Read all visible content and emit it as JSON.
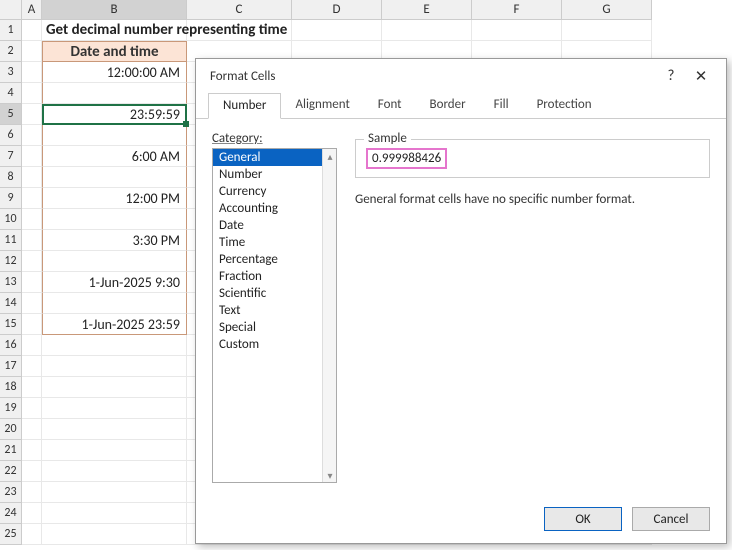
{
  "columns": [
    "A",
    "B",
    "C",
    "D",
    "E",
    "F",
    "G"
  ],
  "selected_col": "B",
  "selected_row": 5,
  "title_cell": "Get decimal number representing time",
  "header_cell": "Date and time",
  "data_rows": [
    {
      "r": 3,
      "v": "12:00:00 AM"
    },
    {
      "r": 4,
      "v": ""
    },
    {
      "r": 5,
      "v": "23:59:59"
    },
    {
      "r": 6,
      "v": ""
    },
    {
      "r": 7,
      "v": "6:00 AM"
    },
    {
      "r": 8,
      "v": ""
    },
    {
      "r": 9,
      "v": "12:00 PM"
    },
    {
      "r": 10,
      "v": ""
    },
    {
      "r": 11,
      "v": "3:30 PM"
    },
    {
      "r": 12,
      "v": ""
    },
    {
      "r": 13,
      "v": "1-Jun-2025 9:30"
    },
    {
      "r": 14,
      "v": ""
    },
    {
      "r": 15,
      "v": "1-Jun-2025 23:59"
    }
  ],
  "dialog": {
    "title": "Format Cells",
    "help": "?",
    "close": "✕",
    "tabs": [
      "Number",
      "Alignment",
      "Font",
      "Border",
      "Fill",
      "Protection"
    ],
    "active_tab": "Number",
    "category_label": "Category:",
    "categories": [
      "General",
      "Number",
      "Currency",
      "Accounting",
      "Date",
      "Time",
      "Percentage",
      "Fraction",
      "Scientific",
      "Text",
      "Special",
      "Custom"
    ],
    "selected_category": "General",
    "sample_label": "Sample",
    "sample_value": "0.999988426",
    "description": "General format cells have no specific number format.",
    "ok": "OK",
    "cancel": "Cancel"
  }
}
